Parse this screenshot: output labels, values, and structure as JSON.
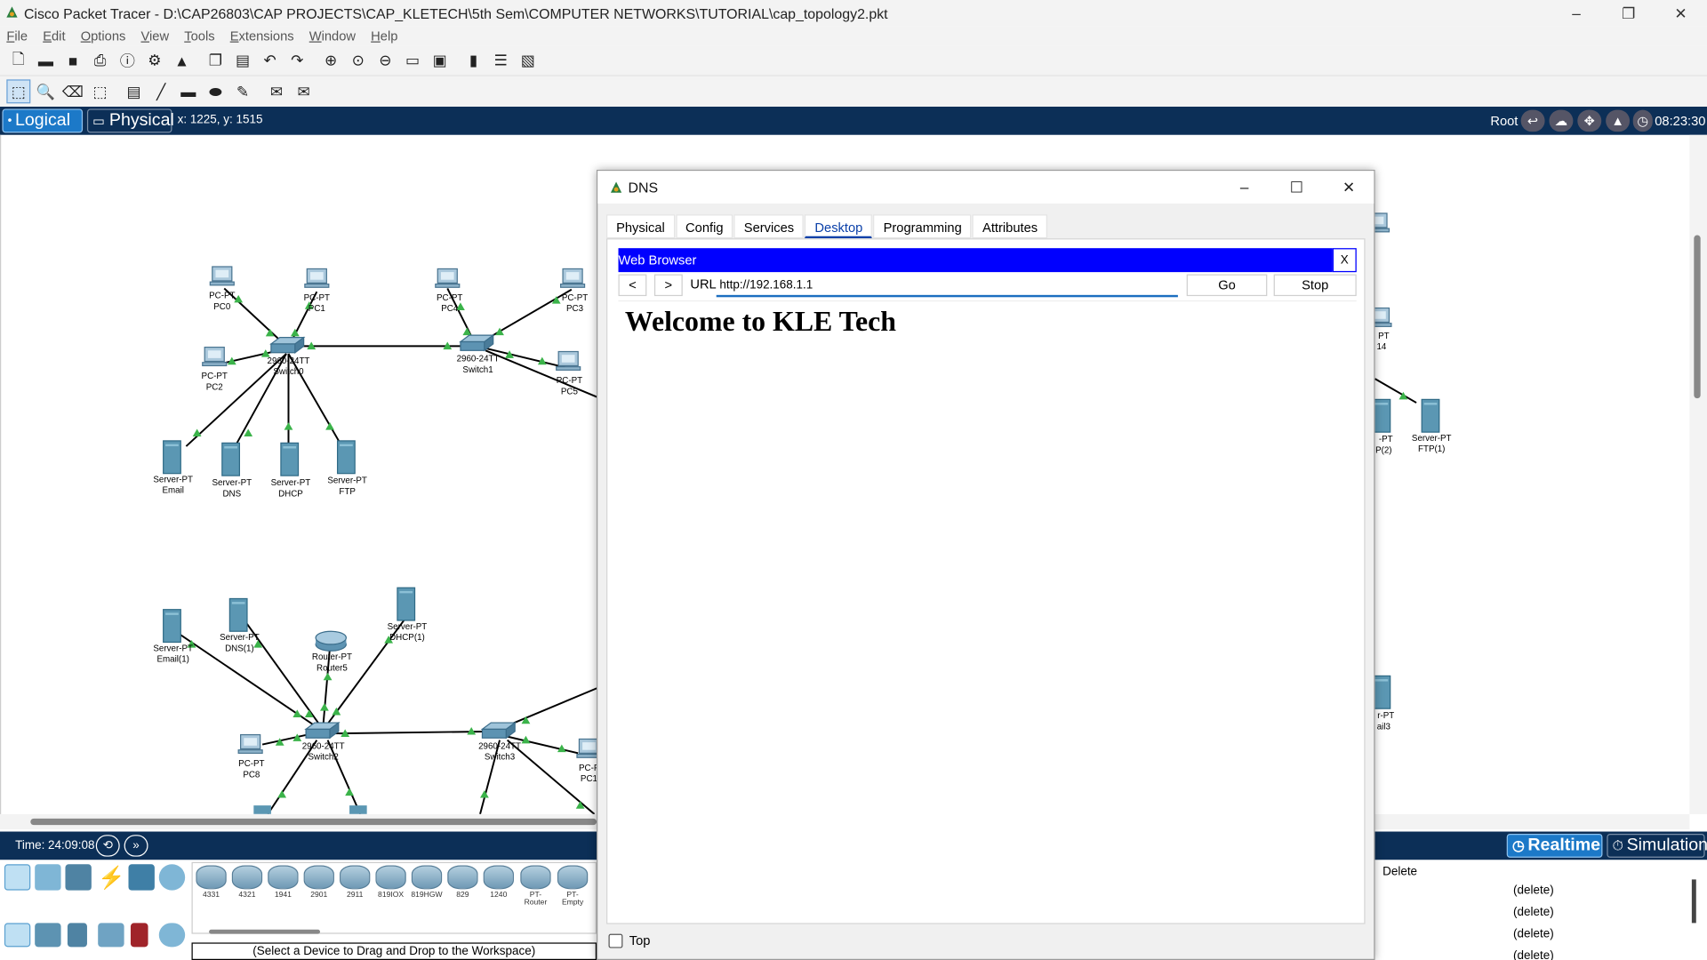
{
  "window": {
    "title": "Cisco Packet Tracer - D:\\CAP26803\\CAP PROJECTS\\CAP_KLETECH\\5th Sem\\COMPUTER NETWORKS\\TUTORIAL\\cap_topology2.pkt",
    "minimize": "–",
    "maximize": "❐",
    "close": "✕"
  },
  "menu": [
    "File",
    "Edit",
    "Options",
    "View",
    "Tools",
    "Extensions",
    "Window",
    "Help"
  ],
  "help_label": "?",
  "workspace_bar": {
    "logical": "Logical",
    "physical": "Physical",
    "coords": "x: 1225, y: 1515",
    "root": "Root",
    "clock": "08:23:30"
  },
  "topology": {
    "devices": [
      {
        "type": "PC-PT",
        "name": "PC0"
      },
      {
        "type": "PC-PT",
        "name": "PC1"
      },
      {
        "type": "PC-PT",
        "name": "PC2"
      },
      {
        "type": "PC-PT",
        "name": "PC4"
      },
      {
        "type": "PC-PT",
        "name": "PC3"
      },
      {
        "type": "PC-PT",
        "name": "PC5"
      },
      {
        "type": "2960-24TT",
        "name": "Switch0"
      },
      {
        "type": "2960-24TT",
        "name": "Switch1"
      },
      {
        "type": "Server-PT",
        "name": "Email"
      },
      {
        "type": "Server-PT",
        "name": "DNS"
      },
      {
        "type": "Server-PT",
        "name": "DHCP"
      },
      {
        "type": "Server-PT",
        "name": "FTP"
      },
      {
        "type": "Server-PT",
        "name": "Email(1)"
      },
      {
        "type": "Server-PT",
        "name": "DNS(1)"
      },
      {
        "type": "Router-PT",
        "name": "Router5"
      },
      {
        "type": "Server-PT",
        "name": "DHCP(1)"
      },
      {
        "type": "2960-24TT",
        "name": "Switch2"
      },
      {
        "type": "2960-24TT",
        "name": "Switch3"
      },
      {
        "type": "PC-PT",
        "name": "PC8"
      },
      {
        "type": "PC-F",
        "name": "PC1"
      },
      {
        "type": "Server-PT",
        "name": "FTP(1)"
      },
      {
        "type": "-PT",
        "name": "P(2)"
      },
      {
        "type": "PT",
        "name": "14"
      },
      {
        "type": "r-PT",
        "name": "ail3"
      }
    ]
  },
  "time_bar": {
    "time": "Time: 24:09:08",
    "realtime": "Realtime",
    "simulation": "Simulation"
  },
  "device_models": [
    "4331",
    "4321",
    "1941",
    "2901",
    "2911",
    "819IOX",
    "819HGW",
    "829",
    "1240",
    "PT-Router",
    "PT-Empty"
  ],
  "select_hint": "(Select a Device to Drag and Drop to the Workspace)",
  "pdu_panel": {
    "header": "Delete",
    "rows": [
      "(delete)",
      "(delete)",
      "(delete)",
      "(delete)"
    ]
  },
  "dialog": {
    "title": "DNS",
    "tabs": [
      "Physical",
      "Config",
      "Services",
      "Desktop",
      "Programming",
      "Attributes"
    ],
    "active_tab": "Desktop",
    "browser": {
      "title": "Web Browser",
      "close": "X",
      "back": "<",
      "forward": ">",
      "url_label": "URL",
      "url": "http://192.168.1.1",
      "go": "Go",
      "stop": "Stop",
      "page_heading": "Welcome to KLE Tech"
    },
    "top_checkbox": "Top"
  }
}
